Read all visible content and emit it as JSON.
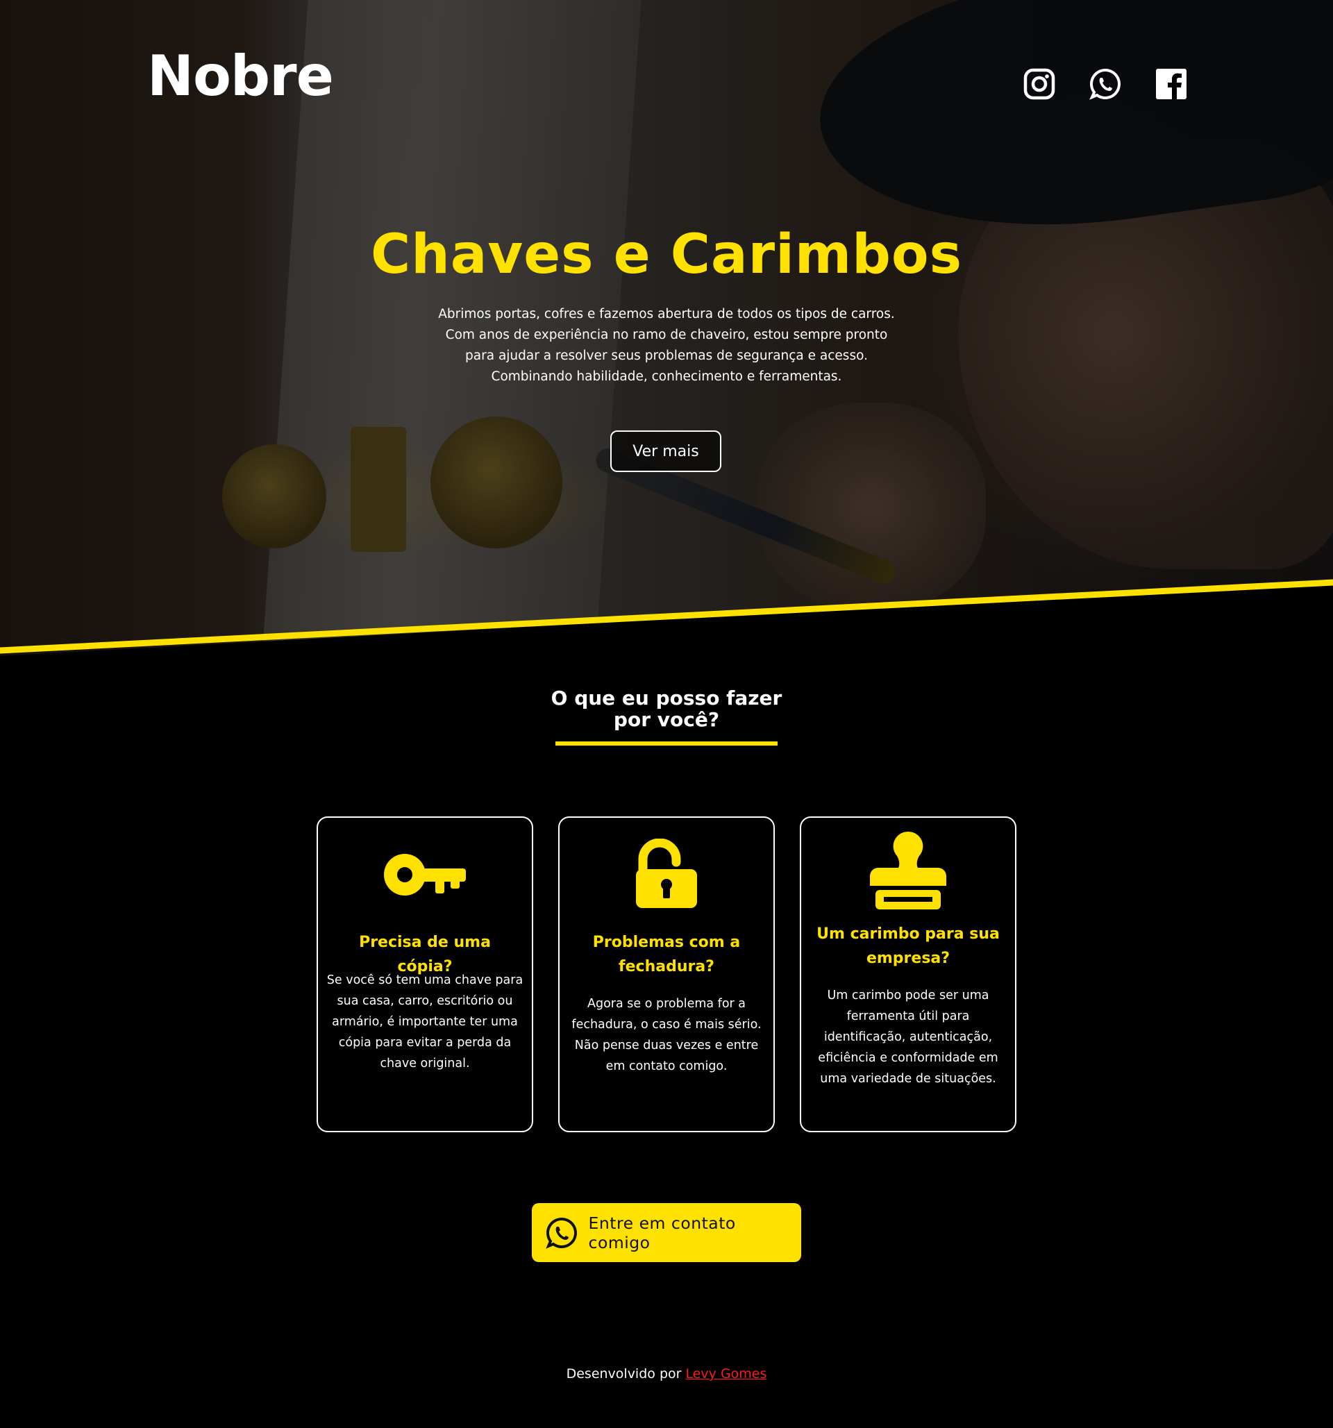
{
  "brand": {
    "logo": "Nobre"
  },
  "social": [
    {
      "icon": "instagram-icon"
    },
    {
      "icon": "whatsapp-icon"
    },
    {
      "icon": "facebook-icon"
    }
  ],
  "hero": {
    "title": "Chaves e Carimbos",
    "lines": [
      "Abrimos portas, cofres e fazemos abertura de todos os tipos de carros.",
      "Com anos de experiência no ramo de chaveiro, estou sempre pronto",
      "para ajudar a resolver seus problemas de segurança e acesso.",
      "Combinando habilidade, conhecimento e ferramentas."
    ],
    "button": "Ver mais"
  },
  "services": {
    "title_line1": "O que eu posso fazer",
    "title_line2": "por você?",
    "cards": [
      {
        "icon": "key-icon",
        "title_lines": [
          "Precisa de uma cópia?"
        ],
        "text_lines": [
          "Se você só tem uma chave para",
          "sua casa, carro, escritório ou",
          "armário, é importante ter uma",
          "cópia para evitar a perda da",
          "chave original."
        ]
      },
      {
        "icon": "unlocked-padlock-icon",
        "title_lines": [
          "Problemas com a",
          "fechadura?"
        ],
        "text_lines": [
          "Agora se o problema for a",
          "fechadura, o caso é mais sério.",
          "Não pense duas vezes e entre",
          "em contato comigo."
        ]
      },
      {
        "icon": "stamp-icon",
        "title_lines": [
          "Um carimbo para sua",
          "empresa?"
        ],
        "text_lines": [
          "Um carimbo pode ser uma",
          "ferramenta útil para",
          "identificação, autenticação,",
          "eficiência e conformidade em",
          "uma variedade de situações."
        ]
      }
    ]
  },
  "contact": {
    "icon": "whatsapp-icon",
    "label": "Entre em contato comigo"
  },
  "footer": {
    "prefix": "Desenvolvido por",
    "author": "Levy Gomes"
  },
  "colors": {
    "accent": "#ffe100",
    "background": "#000000",
    "link": "#ff1a1a"
  }
}
